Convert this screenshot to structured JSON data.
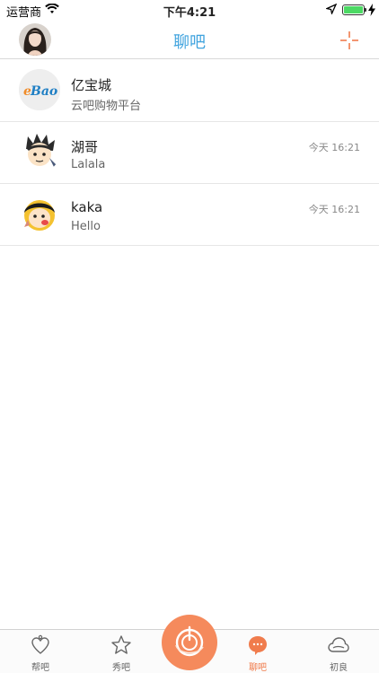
{
  "status_bar": {
    "carrier": "运营商",
    "time": "下午4:21"
  },
  "nav": {
    "title": "聊吧"
  },
  "chats": [
    {
      "name": "亿宝城",
      "preview": "云吧购物平台",
      "time": "",
      "logo_text": "eBao",
      "icon": "ebao-logo"
    },
    {
      "name": "湖哥",
      "preview": "Lalala",
      "time": "今天 16:21",
      "icon": "cartoon-avatar"
    },
    {
      "name": "kaka",
      "preview": "Hello",
      "time": "今天 16:21",
      "icon": "cartoon-avatar"
    }
  ],
  "tabs": [
    {
      "label": "帮吧",
      "icon": "heart-hand-icon",
      "active": false
    },
    {
      "label": "秀吧",
      "icon": "star-icon",
      "active": false
    },
    {
      "label": "聊吧",
      "icon": "chat-bubble-icon",
      "active": true
    },
    {
      "label": "初良",
      "icon": "cloud-icon",
      "active": false
    }
  ],
  "colors": {
    "accent_blue": "#3fa3de",
    "accent_orange": "#f07c4d",
    "center_button": "#f58a5c"
  }
}
